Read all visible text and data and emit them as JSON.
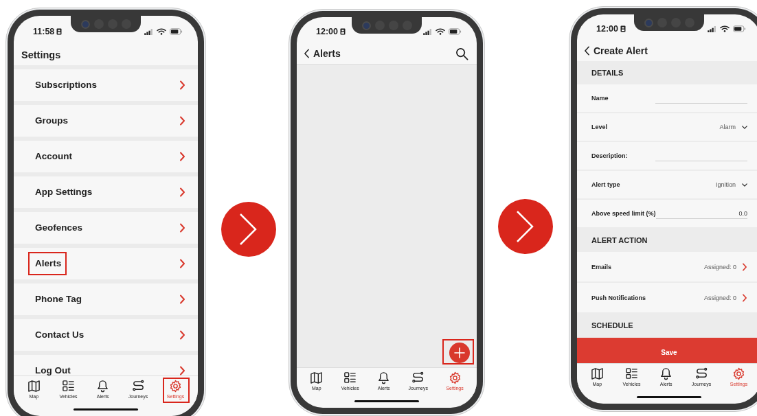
{
  "screens": [
    {
      "kind": "settings",
      "status_time": "11:58",
      "title": "Settings",
      "items": [
        {
          "label": "Subscriptions",
          "highlighted": false
        },
        {
          "label": "Groups",
          "highlighted": false
        },
        {
          "label": "Account",
          "highlighted": false
        },
        {
          "label": "App Settings",
          "highlighted": false
        },
        {
          "label": "Geofences",
          "highlighted": false
        },
        {
          "label": "Alerts",
          "highlighted": true
        },
        {
          "label": "Phone Tag",
          "highlighted": false
        },
        {
          "label": "Contact Us",
          "highlighted": false
        },
        {
          "label": "Log Out",
          "highlighted": false
        }
      ],
      "tabs": [
        {
          "label": "Map",
          "selected": false,
          "highlighted": false
        },
        {
          "label": "Vehicles",
          "selected": false,
          "highlighted": false
        },
        {
          "label": "Alerts",
          "selected": false,
          "highlighted": false
        },
        {
          "label": "Journeys",
          "selected": false,
          "highlighted": false
        },
        {
          "label": "Settings",
          "selected": true,
          "highlighted": true
        }
      ]
    },
    {
      "kind": "alerts",
      "status_time": "12:00",
      "title": "Alerts",
      "add_button": {
        "highlighted": true
      },
      "tabs": [
        {
          "label": "Map",
          "selected": false,
          "highlighted": false
        },
        {
          "label": "Vehicles",
          "selected": false,
          "highlighted": false
        },
        {
          "label": "Alerts",
          "selected": false,
          "highlighted": false
        },
        {
          "label": "Journeys",
          "selected": false,
          "highlighted": false
        },
        {
          "label": "Settings",
          "selected": true,
          "highlighted": false
        }
      ]
    },
    {
      "kind": "create_alert",
      "status_time": "12:00",
      "title": "Create Alert",
      "sections": [
        {
          "heading": "DETAILS",
          "rows": [
            {
              "kind": "text",
              "label": "Name"
            },
            {
              "kind": "dropdown",
              "label": "Level",
              "value": "Alarm"
            },
            {
              "kind": "text",
              "label": "Description:"
            },
            {
              "kind": "dropdown",
              "label": "Alert type",
              "value": "Ignition"
            },
            {
              "kind": "number",
              "label": "Above speed limit (%)",
              "value": "0.0"
            }
          ]
        },
        {
          "heading": "ALERT ACTION",
          "rows": [
            {
              "kind": "link",
              "label": "Emails",
              "value": "Assigned: 0"
            },
            {
              "kind": "link",
              "label": "Push Notifications",
              "value": "Assigned: 0"
            }
          ]
        },
        {
          "heading": "SCHEDULE"
        }
      ],
      "save_button": "Save",
      "tabs": [
        {
          "label": "Map",
          "selected": false,
          "highlighted": false
        },
        {
          "label": "Vehicles",
          "selected": false,
          "highlighted": false
        },
        {
          "label": "Alerts",
          "selected": false,
          "highlighted": false
        },
        {
          "label": "Journeys",
          "selected": false,
          "highlighted": false
        },
        {
          "label": "Settings",
          "selected": true,
          "highlighted": false
        }
      ]
    }
  ]
}
